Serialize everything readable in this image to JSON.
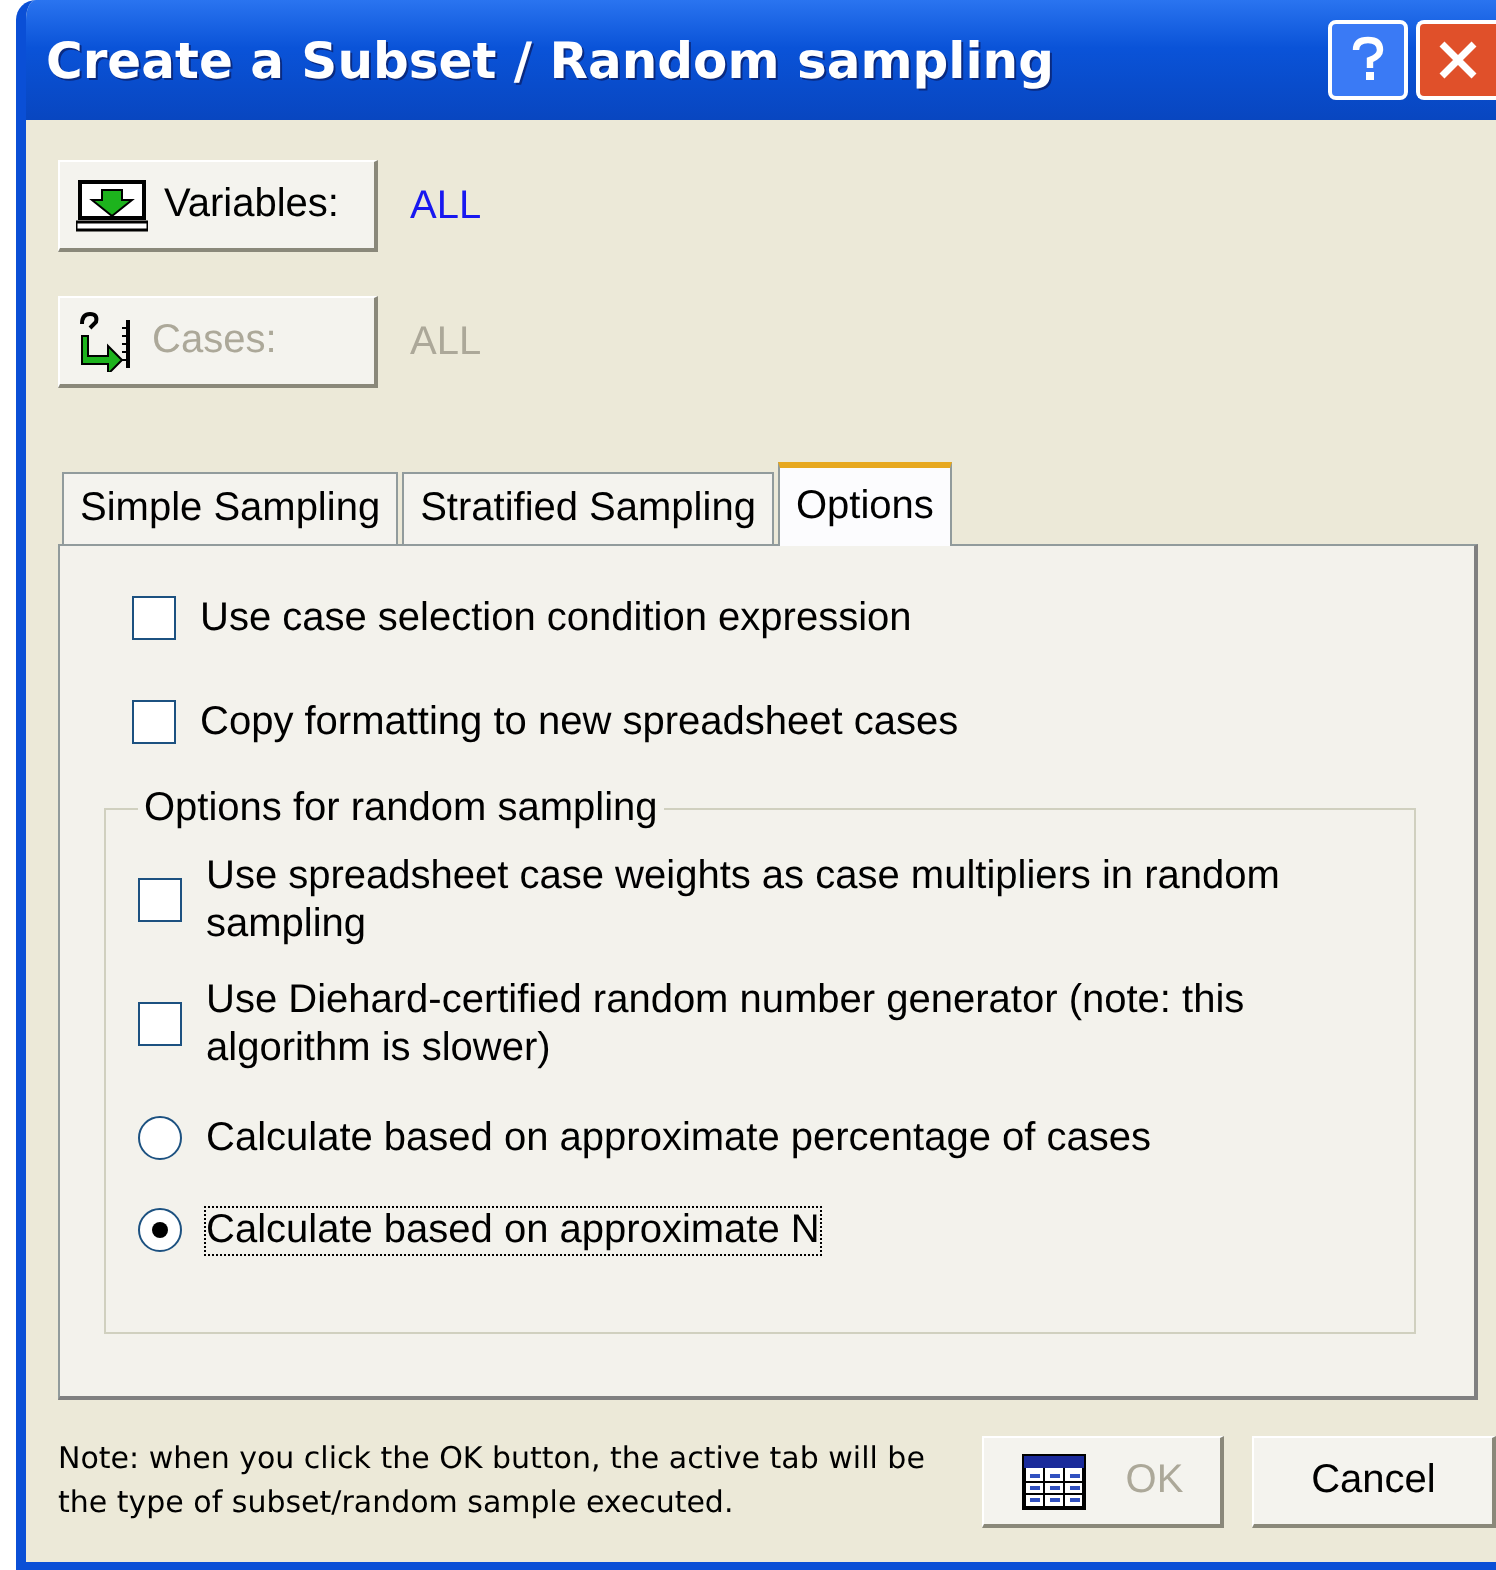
{
  "window": {
    "title": "Create a Subset / Random sampling"
  },
  "selectors": [
    {
      "label": "Variables:",
      "value": "ALL",
      "disabled": false
    },
    {
      "label": "Cases:",
      "value": "ALL",
      "disabled": true
    }
  ],
  "tabs": [
    {
      "label": "Simple Sampling",
      "selected": false
    },
    {
      "label": "Stratified Sampling",
      "selected": false
    },
    {
      "label": "Options",
      "selected": true
    }
  ],
  "options": [
    {
      "label": "Use case selection condition expression",
      "checked": false
    },
    {
      "label": "Copy formatting to new spreadsheet cases",
      "checked": false
    }
  ],
  "random_group": {
    "title": "Options for random sampling",
    "items": [
      {
        "kind": "checkbox",
        "label": "Use spreadsheet case weights as case multipliers in random sampling",
        "checked": false,
        "focused": false
      },
      {
        "kind": "checkbox",
        "label": "Use Diehard-certified random number generator (note: this algorithm is slower)",
        "checked": false,
        "focused": false
      },
      {
        "kind": "radio",
        "label": "Calculate based on approximate percentage of cases",
        "selected": false,
        "focused": false
      },
      {
        "kind": "radio",
        "label": "Calculate based on approximate N",
        "selected": true,
        "focused": true
      }
    ]
  },
  "note": "Note: when you click the OK button, the active tab will be the type of subset/random sample executed.",
  "buttons": [
    {
      "label": "OK",
      "disabled": true
    },
    {
      "label": "Cancel",
      "disabled": false
    }
  ]
}
